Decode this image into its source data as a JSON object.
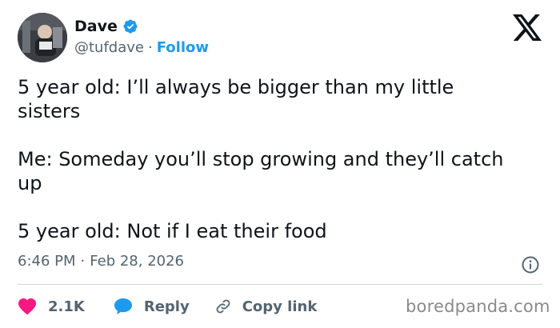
{
  "author": {
    "display_name": "Dave",
    "handle": "@tufdave",
    "separator": "·",
    "follow_label": "Follow",
    "verified_icon": "verified-badge-icon",
    "verified_color": "#1d9bf0"
  },
  "brand_icon": "x-logo-icon",
  "tweet": {
    "paragraphs": [
      {
        "line1": "5 year old: I’ll always be bigger than my little",
        "line2": "sisters"
      },
      {
        "line1": "Me: Someday you’ll stop growing and they’ll catch",
        "line2": "up"
      },
      {
        "line1": "5 year old: Not if I eat their food",
        "line2": ""
      }
    ]
  },
  "meta": {
    "time": "6:46 PM",
    "separator": "·",
    "date": "Feb 28, 2026",
    "info_icon": "info-icon"
  },
  "actions": {
    "like_count": "2.1K",
    "like_icon": "heart-icon",
    "like_color": "#f91880",
    "reply_label": "Reply",
    "reply_icon": "speech-bubble-icon",
    "reply_color": "#1d9bf0",
    "copy_label": "Copy link",
    "copy_icon": "link-icon"
  },
  "watermark": "boredpanda.com",
  "colors": {
    "accent": "#1d9bf0",
    "text": "#0f1419",
    "secondary": "#536471"
  }
}
